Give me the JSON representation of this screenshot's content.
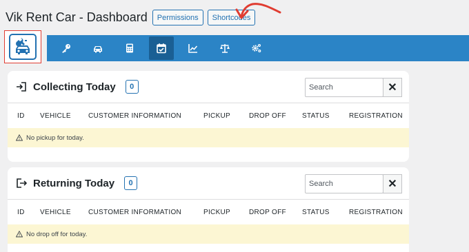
{
  "header": {
    "title": "Vik Rent Car - Dashboard",
    "buttons": [
      "Permissions",
      "Shortcodes"
    ]
  },
  "annotation_color": "#e03c31",
  "menubar": {
    "color": "#2b84c6",
    "items": [
      {
        "icon": "key-icon"
      },
      {
        "icon": "car-icon"
      },
      {
        "icon": "calculator-icon"
      },
      {
        "icon": "calendar-check-icon",
        "active": true
      },
      {
        "icon": "chart-line-icon"
      },
      {
        "icon": "balance-scale-icon"
      },
      {
        "icon": "gears-icon"
      }
    ]
  },
  "columns": [
    "ID",
    "VEHICLE",
    "CUSTOMER INFORMATION",
    "PICKUP",
    "DROP OFF",
    "STATUS",
    "REGISTRATION"
  ],
  "panels": {
    "collecting": {
      "title": "Collecting Today",
      "count": "0",
      "search_placeholder": "Search",
      "clear": "✕",
      "notice": "No pickup for today."
    },
    "returning": {
      "title": "Returning Today",
      "count": "0",
      "search_placeholder": "Search",
      "clear": "✕",
      "notice": "No drop off for today."
    }
  }
}
